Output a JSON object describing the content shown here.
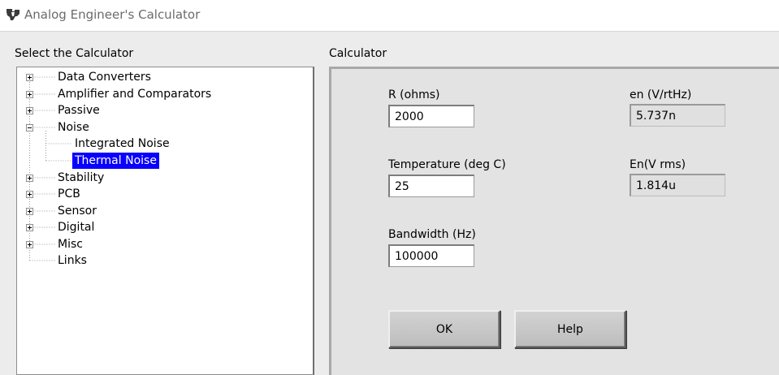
{
  "window": {
    "title": "Analog Engineer's Calculator"
  },
  "tree": {
    "heading": "Select the Calculator",
    "items": [
      {
        "label": "Data Converters",
        "level": 0,
        "expander": "plus"
      },
      {
        "label": "Amplifier and Comparators",
        "level": 0,
        "expander": "plus"
      },
      {
        "label": "Passive",
        "level": 0,
        "expander": "plus"
      },
      {
        "label": "Noise",
        "level": 0,
        "expander": "minus"
      },
      {
        "label": "Integrated Noise",
        "level": 1,
        "expander": "none"
      },
      {
        "label": "Thermal Noise",
        "level": 1,
        "expander": "none",
        "selected": true
      },
      {
        "label": "Stability",
        "level": 0,
        "expander": "plus"
      },
      {
        "label": "PCB",
        "level": 0,
        "expander": "plus"
      },
      {
        "label": "Sensor",
        "level": 0,
        "expander": "plus"
      },
      {
        "label": "Digital",
        "level": 0,
        "expander": "plus"
      },
      {
        "label": "Misc",
        "level": 0,
        "expander": "plus"
      },
      {
        "label": "Links",
        "level": 0,
        "expander": "none"
      }
    ]
  },
  "calculator": {
    "heading": "Calculator",
    "r": {
      "label": "R (ohms)",
      "value": "2000"
    },
    "temperature": {
      "label": "Temperature (deg C)",
      "value": "25"
    },
    "bandwidth": {
      "label": "Bandwidth (Hz)",
      "value": "100000"
    },
    "en": {
      "label": "en (V/rtHz)",
      "value": "5.737n"
    },
    "en_rms": {
      "label": "En(V rms)",
      "value": "1.814u"
    },
    "ok_label": "OK",
    "help_label": "Help"
  },
  "colors": {
    "selection": "#0a00ff",
    "panel": "#e3e3e3",
    "ti_red": "#cc0000"
  }
}
